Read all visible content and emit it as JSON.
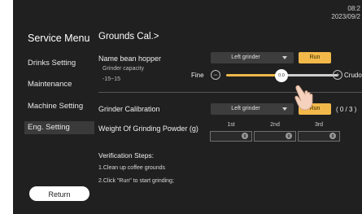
{
  "status": {
    "time": "08:2",
    "date": "2023/09/2"
  },
  "sidebar": {
    "title": "Service Menu",
    "items": [
      {
        "label": "Drinks Setting"
      },
      {
        "label": "Maintenance"
      },
      {
        "label": "Machine Setting"
      },
      {
        "label": "Eng. Setting",
        "active": true
      }
    ],
    "return_label": "Return"
  },
  "main": {
    "title": "Grounds Cal.>",
    "hopper": {
      "label": "Name bean hopper",
      "select_value": "Left grinder",
      "run_label": "Run"
    },
    "capacity": {
      "label": "Grinder capacity",
      "range": "-15~15",
      "fine_label": "Fine",
      "coarse_label": "Crudo",
      "value": "0.0",
      "minus_symbol": "−",
      "plus_symbol": "+"
    },
    "calibration": {
      "label": "Grinder Calibration",
      "select_value": "Left grinder",
      "run_label": "Run",
      "progress": "( 0 / 3 )"
    },
    "weight": {
      "label": "Weight Of Grinding Powder (g)",
      "columns": [
        "1st",
        "2nd",
        "3rd"
      ],
      "unit_symbol": "g"
    },
    "verification": {
      "title": "Verification Steps:",
      "steps": [
        "1.Clean up coffee grounds",
        "2.Click \"Run\" to start grinding;"
      ]
    }
  },
  "colors": {
    "accent": "#f2b94a",
    "background": "#202020",
    "panel": "#3d3d3d"
  }
}
